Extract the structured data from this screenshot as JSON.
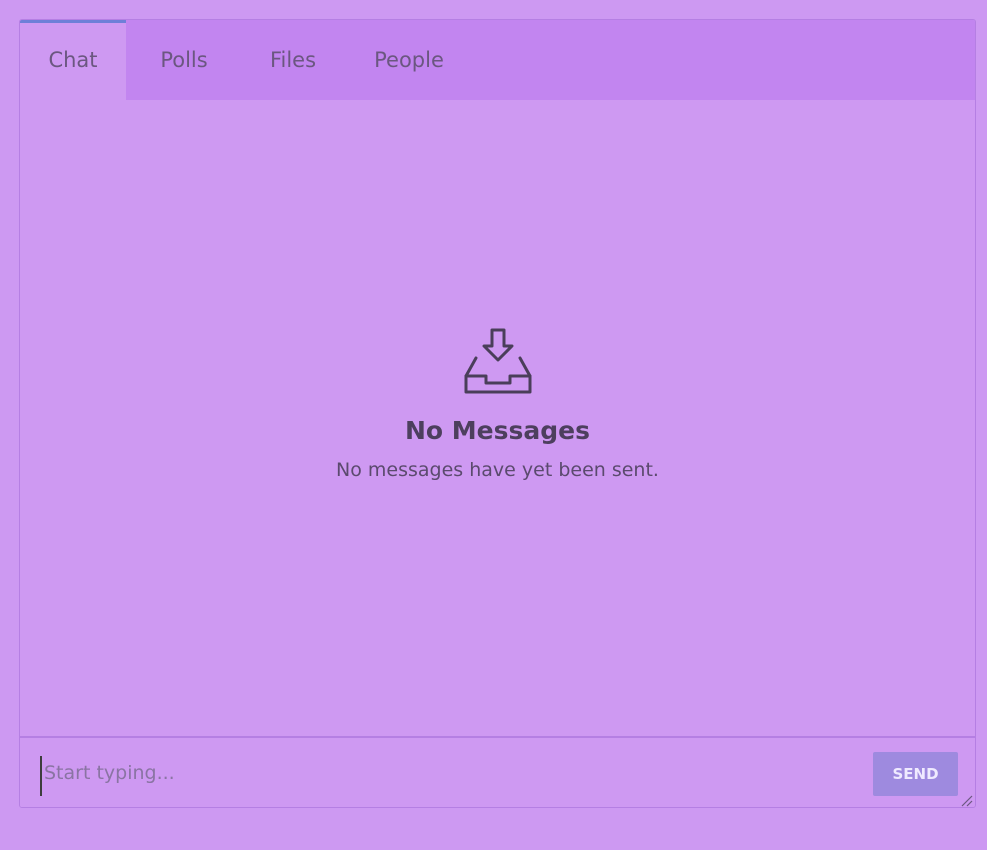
{
  "tabs": [
    {
      "label": "Chat",
      "active": true
    },
    {
      "label": "Polls",
      "active": false
    },
    {
      "label": "Files",
      "active": false
    },
    {
      "label": "People",
      "active": false
    }
  ],
  "empty_state": {
    "icon": "inbox-download-icon",
    "title": "No Messages",
    "subtitle": "No messages have yet been sent."
  },
  "composer": {
    "placeholder": "Start typing...",
    "value": "",
    "send_label": "SEND"
  },
  "colors": {
    "background": "#cd99f2",
    "tabbar": "#c285f0",
    "active_tab_indicator": "#6e7fd8",
    "send_button": "#9e8adf"
  }
}
